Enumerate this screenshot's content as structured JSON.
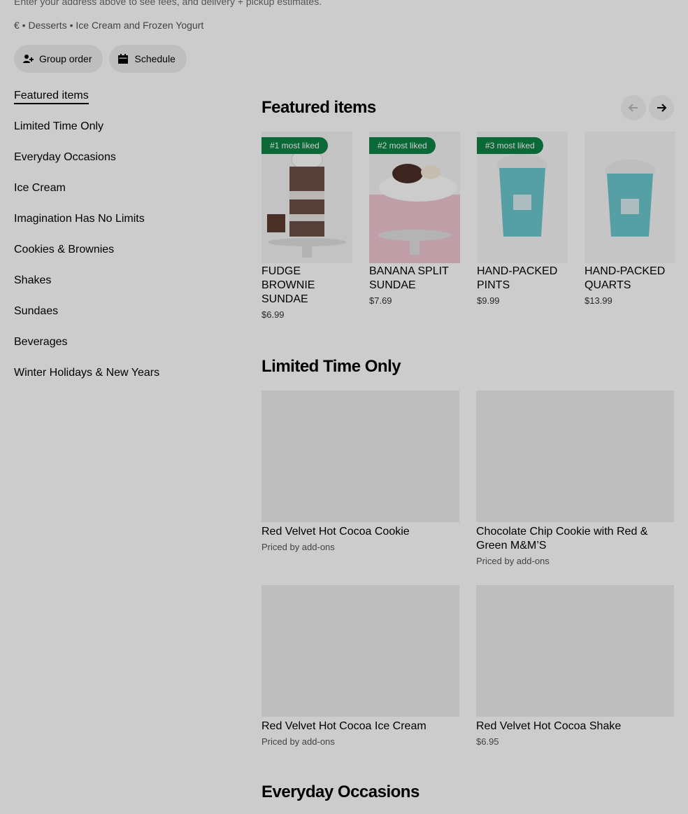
{
  "header": {
    "hint": "Enter your address above to see fees, and delivery + pickup estimates.",
    "meta": "€ • Desserts • Ice Cream and Frozen Yogurt",
    "group_order": "Group order",
    "schedule": "Schedule"
  },
  "sidebar": {
    "items": [
      {
        "label": "Featured items"
      },
      {
        "label": "Limited Time Only"
      },
      {
        "label": "Everyday Occasions"
      },
      {
        "label": "Ice Cream"
      },
      {
        "label": "Imagination Has No Limits"
      },
      {
        "label": "Cookies & Brownies"
      },
      {
        "label": "Shakes"
      },
      {
        "label": "Sundaes"
      },
      {
        "label": "Beverages"
      },
      {
        "label": "Winter Holidays & New Years"
      }
    ]
  },
  "featured": {
    "title": "Featured items",
    "items": [
      {
        "badge": "#1 most liked",
        "name": "FUDGE BROWNIE SUNDAE",
        "price": "$6.99"
      },
      {
        "badge": "#2 most liked",
        "name": "BANANA SPLIT SUNDAE",
        "price": "$7.69"
      },
      {
        "badge": "#3 most liked",
        "name": "HAND-PACKED PINTS",
        "price": "$9.99"
      },
      {
        "badge": "",
        "name": "HAND-PACKED QUARTS",
        "price": "$13.99"
      }
    ]
  },
  "limited": {
    "title": "Limited Time Only",
    "items": [
      {
        "name": "Red Velvet Hot Cocoa Cookie",
        "price": "Priced by add-ons"
      },
      {
        "name": "Chocolate Chip Cookie with Red & Green M&M’S",
        "price": "Priced by add-ons"
      },
      {
        "name": "Red Velvet Hot Cocoa Ice Cream",
        "price": "Priced by add-ons"
      },
      {
        "name": "Red Velvet Hot Cocoa Shake",
        "price": "$6.95"
      }
    ]
  },
  "everyday": {
    "title": "Everyday Occasions"
  },
  "colors": {
    "badge": "#0e8345",
    "overlay": "rgba(0,0,0,0.2)"
  }
}
